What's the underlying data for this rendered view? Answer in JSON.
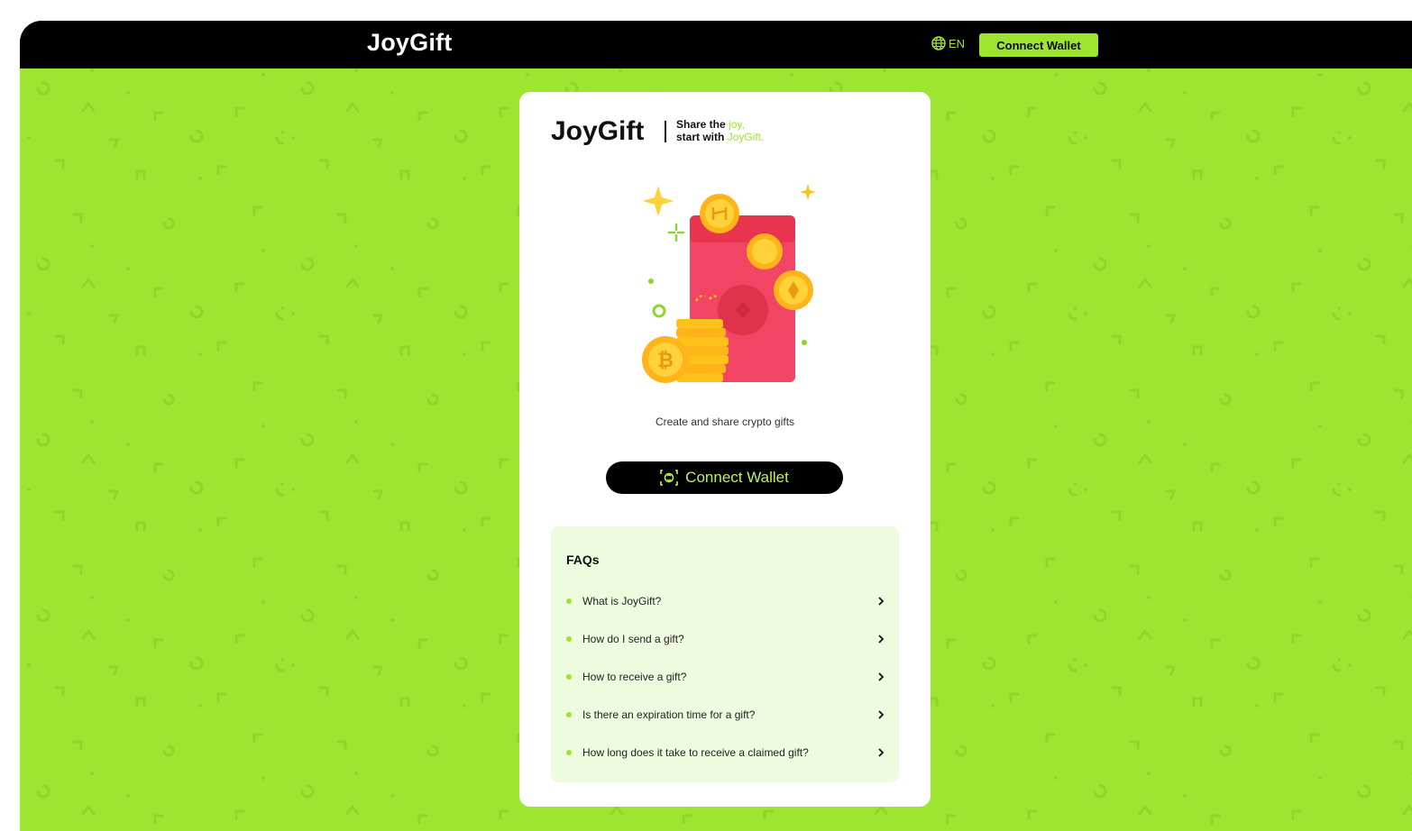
{
  "header": {
    "brand": "JoyGift",
    "language": "EN",
    "connect_label": "Connect Wallet"
  },
  "card": {
    "logo": "JoyGift",
    "tagline_line1_prefix": "Share the ",
    "tagline_line1_highlight": "joy,",
    "tagline_line2_prefix": "start with ",
    "tagline_line2_highlight": "JoyGift.",
    "subtitle": "Create and share crypto gifts",
    "connect_label": "Connect Wallet"
  },
  "faq": {
    "title": "FAQs",
    "items": [
      {
        "question": "What is JoyGift?"
      },
      {
        "question": "How do I send a gift?"
      },
      {
        "question": "How to receive a gift?"
      },
      {
        "question": "Is there an expiration time for a gift?"
      },
      {
        "question": "How long does it take to receive a claimed gift?"
      }
    ]
  },
  "colors": {
    "accent": "#9ee531",
    "background": "#9ee531",
    "header": "#000000",
    "envelope": "#f24463",
    "coin": "#ffc21a",
    "faq_bg": "#eefbde"
  },
  "icons": {
    "globe": "globe-icon",
    "wallet": "wallet-icon",
    "chevron": "chevron-right-icon"
  }
}
